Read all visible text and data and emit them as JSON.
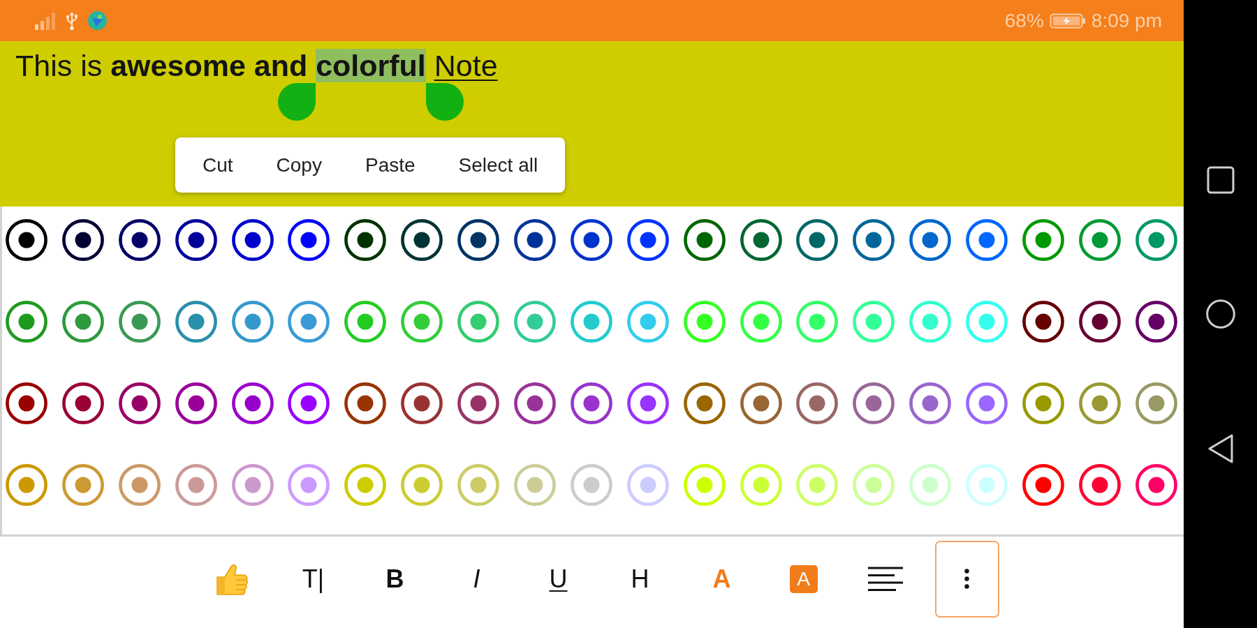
{
  "status_bar": {
    "battery_text": "68%",
    "time": "8:09 pm"
  },
  "editor": {
    "segments": [
      {
        "text": "This is ",
        "bold": false,
        "underline": false,
        "selected": false
      },
      {
        "text": "awesome and ",
        "bold": true,
        "underline": false,
        "selected": false
      },
      {
        "text": "colorful",
        "bold": true,
        "underline": false,
        "selected": true
      },
      {
        "text": " Note",
        "bold": false,
        "underline": true,
        "selected": false
      }
    ],
    "context_menu": [
      {
        "label": "Cut"
      },
      {
        "label": "Copy"
      },
      {
        "label": "Paste"
      },
      {
        "label": "Select all"
      }
    ]
  },
  "palette": {
    "swatches": [
      {
        "color": "#000000"
      },
      {
        "color": "#000033"
      },
      {
        "color": "#000066"
      },
      {
        "color": "#000099"
      },
      {
        "color": "#0000cc"
      },
      {
        "color": "#0000ff"
      },
      {
        "color": "#003300"
      },
      {
        "color": "#003333"
      },
      {
        "color": "#003366"
      },
      {
        "color": "#003399"
      },
      {
        "color": "#0033cc"
      },
      {
        "color": "#0033ff"
      },
      {
        "color": "#006600"
      },
      {
        "color": "#006633"
      },
      {
        "color": "#006666"
      },
      {
        "color": "#006699"
      },
      {
        "color": "#0066cc"
      },
      {
        "color": "#0066ff"
      },
      {
        "color": "#009900"
      },
      {
        "color": "#009933"
      },
      {
        "color": "#009966"
      },
      {
        "color": "#1e9a1e"
      },
      {
        "color": "#2d9a3c"
      },
      {
        "color": "#3a9a55"
      },
      {
        "color": "#2a8faa"
      },
      {
        "color": "#3399cc"
      },
      {
        "color": "#3a9bd6"
      },
      {
        "color": "#22cc22"
      },
      {
        "color": "#33cc3a"
      },
      {
        "color": "#33cc70"
      },
      {
        "color": "#33cc99"
      },
      {
        "color": "#22cccc"
      },
      {
        "color": "#33ccee"
      },
      {
        "color": "#33ff22"
      },
      {
        "color": "#33ff44"
      },
      {
        "color": "#33ff66"
      },
      {
        "color": "#33ff99"
      },
      {
        "color": "#33ffcc"
      },
      {
        "color": "#33ffee"
      },
      {
        "color": "#660000"
      },
      {
        "color": "#660033"
      },
      {
        "color": "#660066"
      },
      {
        "color": "#990000"
      },
      {
        "color": "#990033"
      },
      {
        "color": "#990066"
      },
      {
        "color": "#990099"
      },
      {
        "color": "#9900cc"
      },
      {
        "color": "#9900ff"
      },
      {
        "color": "#993300"
      },
      {
        "color": "#993333"
      },
      {
        "color": "#993366"
      },
      {
        "color": "#993399"
      },
      {
        "color": "#9933cc"
      },
      {
        "color": "#9933ff"
      },
      {
        "color": "#996600"
      },
      {
        "color": "#996633"
      },
      {
        "color": "#996666"
      },
      {
        "color": "#996699"
      },
      {
        "color": "#9966cc"
      },
      {
        "color": "#9966ff"
      },
      {
        "color": "#999900"
      },
      {
        "color": "#999933"
      },
      {
        "color": "#999966"
      },
      {
        "color": "#cc9900"
      },
      {
        "color": "#cc9933"
      },
      {
        "color": "#cc9966"
      },
      {
        "color": "#cc9999"
      },
      {
        "color": "#cc99cc"
      },
      {
        "color": "#cc99ff"
      },
      {
        "color": "#cccc00"
      },
      {
        "color": "#cccc33"
      },
      {
        "color": "#cccc66"
      },
      {
        "color": "#cccc99"
      },
      {
        "color": "#cccccc"
      },
      {
        "color": "#ccccff"
      },
      {
        "color": "#ccff00"
      },
      {
        "color": "#ccff33"
      },
      {
        "color": "#ccff66"
      },
      {
        "color": "#ccff99"
      },
      {
        "color": "#ccffcc"
      },
      {
        "color": "#ccffff"
      },
      {
        "color": "#ff0000"
      },
      {
        "color": "#ff0033"
      },
      {
        "color": "#ff0066"
      }
    ]
  },
  "toolbar": [
    {
      "kind": "emoji",
      "selected": false
    },
    {
      "kind": "plain",
      "label": "T|",
      "selected": false
    },
    {
      "kind": "bold",
      "label": "B",
      "selected": false
    },
    {
      "kind": "italic",
      "label": "I",
      "selected": false
    },
    {
      "kind": "underline",
      "label": "U",
      "selected": false
    },
    {
      "kind": "plain",
      "label": "H",
      "selected": false
    },
    {
      "kind": "color",
      "label": "A",
      "color": "#f07d1a",
      "selected": false
    },
    {
      "kind": "highlight",
      "label": "A",
      "color": "#f07d1a",
      "selected": false
    },
    {
      "kind": "align",
      "selected": false
    },
    {
      "kind": "more",
      "selected": true
    }
  ]
}
